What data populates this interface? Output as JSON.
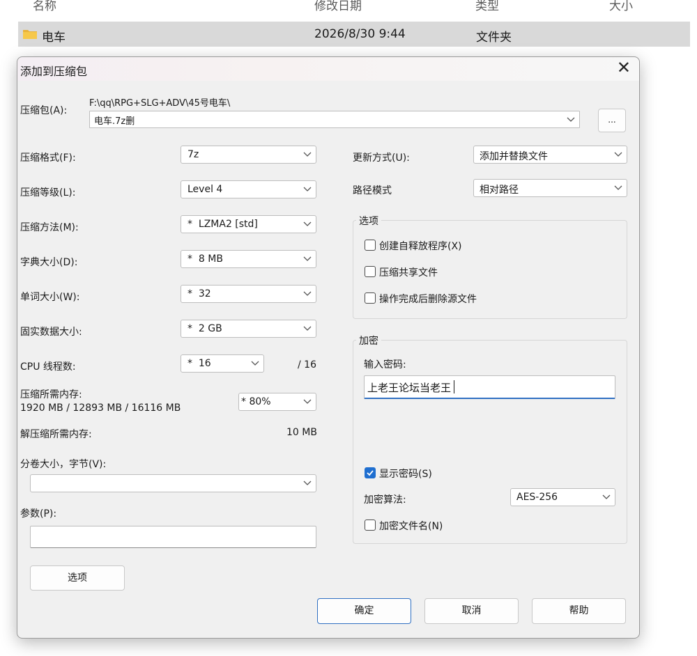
{
  "explorer": {
    "columns": {
      "name": "名称",
      "modified": "修改日期",
      "type": "类型",
      "size": "大小"
    },
    "row": {
      "name": "电车",
      "modified": "2026/8/30 9:44",
      "type": "文件夹"
    }
  },
  "dialog": {
    "title": "添加到压缩包",
    "archive": {
      "label": "压缩包(A):",
      "path": "F:\\qq\\RPG+SLG+ADV\\45号电车\\",
      "filename": "电车.7z删",
      "browse": "..."
    },
    "left": {
      "format": {
        "label": "压缩格式(F):",
        "value": "7z"
      },
      "level": {
        "label": "压缩等级(L):",
        "value": "Level 4"
      },
      "method": {
        "label": "压缩方法(M):",
        "value": "*  LZMA2 [std]"
      },
      "dict": {
        "label": "字典大小(D):",
        "value": "*  8 MB"
      },
      "word": {
        "label": "单词大小(W):",
        "value": "*  32"
      },
      "solid": {
        "label": "固实数据大小:",
        "value": "*  2 GB"
      },
      "cpu": {
        "label": "CPU 线程数:",
        "value": "*  16",
        "total": "/ 16"
      },
      "memory": {
        "label": "压缩所需内存:",
        "detail": "1920 MB / 12893 MB / 16116 MB",
        "value": "* 80%"
      },
      "decomp": {
        "label": "解压缩所需内存:",
        "value": "10 MB"
      },
      "volume": {
        "label": "分卷大小，字节(V):",
        "value": ""
      },
      "params": {
        "label": "参数(P):",
        "value": ""
      },
      "options_button": "选项"
    },
    "right": {
      "update": {
        "label": "更新方式(U):",
        "value": "添加并替换文件"
      },
      "pathmode": {
        "label": "路径模式",
        "value": "相对路径"
      },
      "options": {
        "title": "选项",
        "sfx": {
          "label": "创建自释放程序(X)",
          "checked": false
        },
        "shared": {
          "label": "压缩共享文件",
          "checked": false
        },
        "delete": {
          "label": "操作完成后删除源文件",
          "checked": false
        }
      },
      "encryption": {
        "title": "加密",
        "password_label": "输入密码:",
        "password": "上老王论坛当老王",
        "show_password": {
          "label": "显示密码(S)",
          "checked": true
        },
        "method_label": "加密算法:",
        "method": "AES-256",
        "encrypt_names": {
          "label": "加密文件名(N)",
          "checked": false
        }
      }
    },
    "buttons": {
      "ok": "确定",
      "cancel": "取消",
      "help": "帮助"
    }
  },
  "colors": {
    "accent": "#1f6fd0",
    "primary_border": "#2f6fc2",
    "dialog_bg": "#f0f0f0"
  }
}
